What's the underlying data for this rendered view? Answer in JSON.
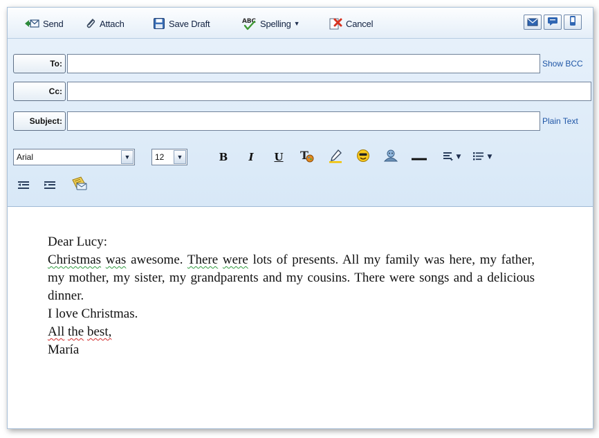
{
  "toolbar": {
    "send_label": "Send",
    "attach_label": "Attach",
    "save_draft_label": "Save Draft",
    "spelling_label": "Spelling",
    "cancel_label": "Cancel"
  },
  "fields": {
    "to_label": "To:",
    "to_value": "",
    "cc_label": "Cc:",
    "cc_value": "",
    "subject_label": "Subject:",
    "subject_value": "",
    "show_bcc_label": "Show BCC",
    "plain_text_label": "Plain Text"
  },
  "formatting": {
    "font_family": "Arial",
    "font_size": "12",
    "bold_label": "B",
    "italic_label": "I",
    "underline_label": "U"
  },
  "message": {
    "greeting": "Dear Lucy:",
    "p1_w1": "Christmas",
    "p1_w2": "was",
    "p1_w3": "awesome.",
    "p1_w4": "There",
    "p1_w5": "were",
    "p1_rest": "lots of presents. All my family was here, my father, my mother, my sister, my grandparents and my cousins. There were songs and a delicious dinner.",
    "line_love": "I love Christmas.",
    "closing_w1": "All",
    "closing_w2": "the",
    "closing_w3": "best,",
    "signature": "María"
  },
  "colors": {
    "chrome_bg": "#dce9f7",
    "link": "#1f56a6",
    "grammar_squiggle": "#2f9a3e",
    "spell_squiggle": "#d22a2a"
  }
}
